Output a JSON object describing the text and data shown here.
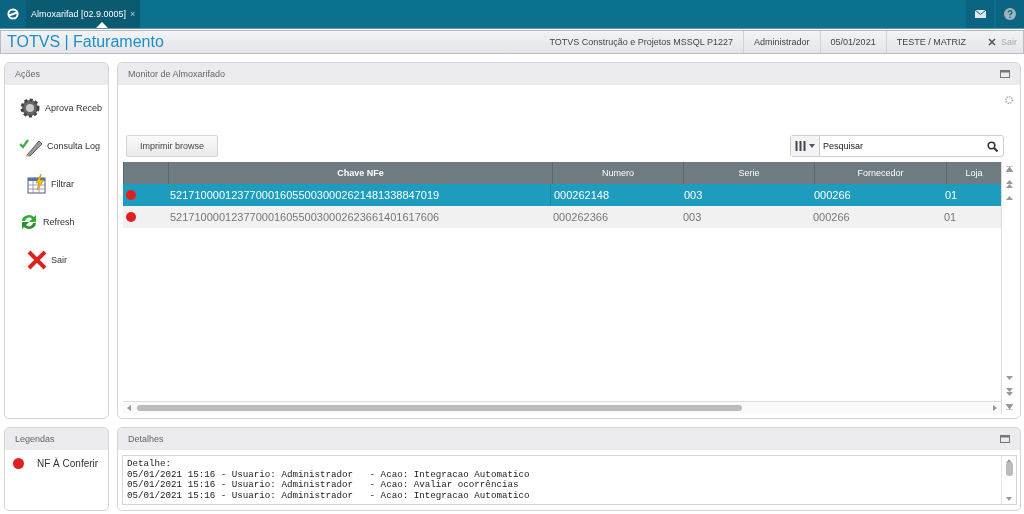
{
  "topbar": {
    "tabs": [
      {
        "label": "Almoxarifad [02.9.0005]",
        "selected": true,
        "close": "×"
      }
    ]
  },
  "header": {
    "title": "TOTVS | Faturamento",
    "info": [
      "TOTVS Construção e Projetos MSSQL P1227",
      "Administrador",
      "05/01/2021",
      "TESTE / MATRIZ"
    ],
    "exit": "Sair"
  },
  "actions": {
    "title": "Ações",
    "items": [
      {
        "kind": "gear",
        "label": "Aprova Receb"
      },
      {
        "kind": "log",
        "label": "Consulta Log"
      },
      {
        "kind": "filter",
        "label": "Filtrar"
      },
      {
        "kind": "refresh",
        "label": "Refresh"
      },
      {
        "kind": "exit",
        "label": "Sair"
      }
    ]
  },
  "monitor": {
    "title": "Monitor de Almoxarifado",
    "print_button": "Imprimir browse",
    "search": {
      "placeholder": "Pesquisar"
    },
    "table": {
      "columns": [
        "Chave NFe",
        "Numero",
        "Serie",
        "Fornecedor",
        "Loja"
      ],
      "rows": [
        {
          "selected": true,
          "color": "#e02020",
          "cells": [
            "52171000012377000160550030002621481338847019",
            "000262148",
            "003",
            "000266",
            "01"
          ]
        },
        {
          "selected": false,
          "color": "#e02020",
          "cells": [
            "52171000012377000160550030002623661401617606",
            "000262366",
            "003",
            "000266",
            "01"
          ]
        }
      ]
    }
  },
  "legend": {
    "title": "Legendas",
    "items": [
      {
        "color": "#e02020",
        "label": "NF À Conferir"
      }
    ]
  },
  "details": {
    "title": "Detalhes",
    "lines": [
      "Detalhe:",
      "05/01/2021 15:16 - Usuario: Administrador   - Acao: Integracao Automatico",
      "05/01/2021 15:16 - Usuario: Administrador   - Acao: Avaliar ocorrências",
      "05/01/2021 15:16 - Usuario: Administrador   - Acao: Integracao Automatico"
    ]
  }
}
